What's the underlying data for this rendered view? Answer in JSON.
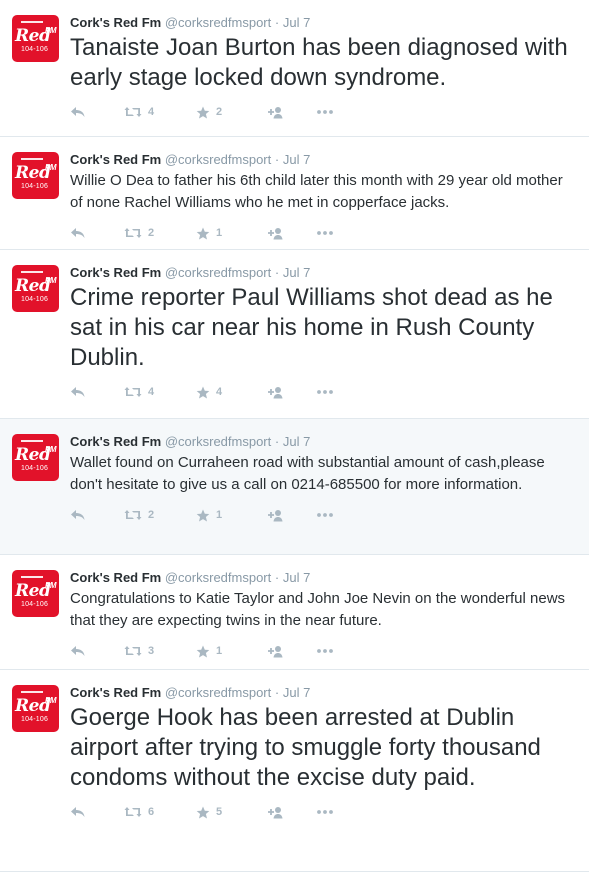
{
  "colors": {
    "brand_red": "#e2122a",
    "text": "#292f33",
    "muted": "#8899a6",
    "icon": "#aab8c2",
    "divider": "#e1e8ed",
    "highlight_bg": "#f5f8fa"
  },
  "avatar": {
    "brand": "Red",
    "suffix": "FM",
    "freq": "104-106"
  },
  "tweets": [
    {
      "name": "Cork's Red Fm",
      "handle": "@corksredfmsport",
      "dot": "·",
      "date": "Jul 7",
      "text": "Tanaiste Joan Burton has been diagnosed with early stage locked down syndrome.",
      "retweets": "4",
      "favorites": "2"
    },
    {
      "name": "Cork's Red Fm",
      "handle": "@corksredfmsport",
      "dot": "·",
      "date": "Jul 7",
      "text": "Willie O Dea to father his 6th child later this month with 29 year old mother of none Rachel Williams who he met in copperface jacks.",
      "retweets": "2",
      "favorites": "1"
    },
    {
      "name": "Cork's Red Fm",
      "handle": "@corksredfmsport",
      "dot": "·",
      "date": "Jul 7",
      "text": "Crime reporter Paul Williams shot dead as he sat in his car near his home in Rush County Dublin.",
      "retweets": "4",
      "favorites": "4"
    },
    {
      "name": "Cork's Red Fm",
      "handle": "@corksredfmsport",
      "dot": "·",
      "date": "Jul 7",
      "text": "Wallet found on Curraheen road with substantial amount of cash,please don't hesitate to give us a call on 0214-685500 for more information.",
      "retweets": "2",
      "favorites": "1"
    },
    {
      "name": "Cork's Red Fm",
      "handle": "@corksredfmsport",
      "dot": "·",
      "date": "Jul 7",
      "text": "Congratulations to Katie Taylor and John Joe Nevin on the wonderful news that they are expecting twins in the near future.",
      "retweets": "3",
      "favorites": "1"
    },
    {
      "name": "Cork's Red Fm",
      "handle": "@corksredfmsport",
      "dot": "·",
      "date": "Jul 7",
      "text": "Goerge Hook has been arrested at Dublin airport after trying to smuggle forty thousand condoms without the excise duty paid.",
      "retweets": "6",
      "favorites": "5"
    }
  ],
  "icons": {
    "reply": "reply-icon",
    "retweet": "retweet-icon",
    "favorite": "star-icon",
    "follow": "follow-icon",
    "more": "more-icon"
  }
}
